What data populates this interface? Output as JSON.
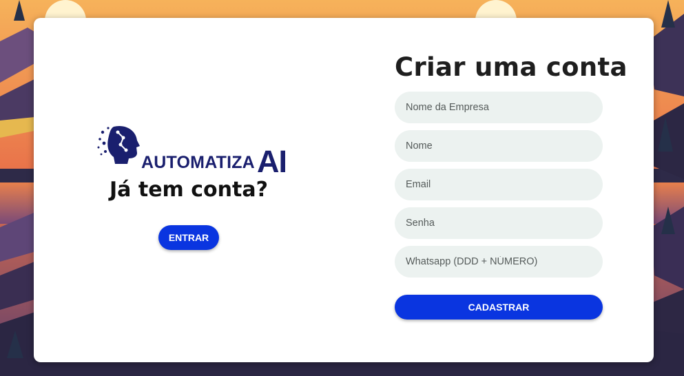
{
  "brand": {
    "logo_text": "AUTOMATIZA",
    "logo_ai": "AI"
  },
  "login": {
    "heading": "Já tem conta?",
    "button_label": "ENTRAR"
  },
  "signup": {
    "title": "Criar uma conta",
    "fields": [
      {
        "placeholder": "Nome da Empresa",
        "value": ""
      },
      {
        "placeholder": "Nome",
        "value": ""
      },
      {
        "placeholder": "Email",
        "value": ""
      },
      {
        "placeholder": "Senha",
        "value": ""
      },
      {
        "placeholder": "Whatsapp (DDD + NÚMERO)",
        "value": ""
      }
    ],
    "submit_label": "CADASTRAR"
  },
  "colors": {
    "primary_button": "#0a35e0",
    "input_bg": "#ecf2f0",
    "logo_navy": "#1a1f6e"
  }
}
